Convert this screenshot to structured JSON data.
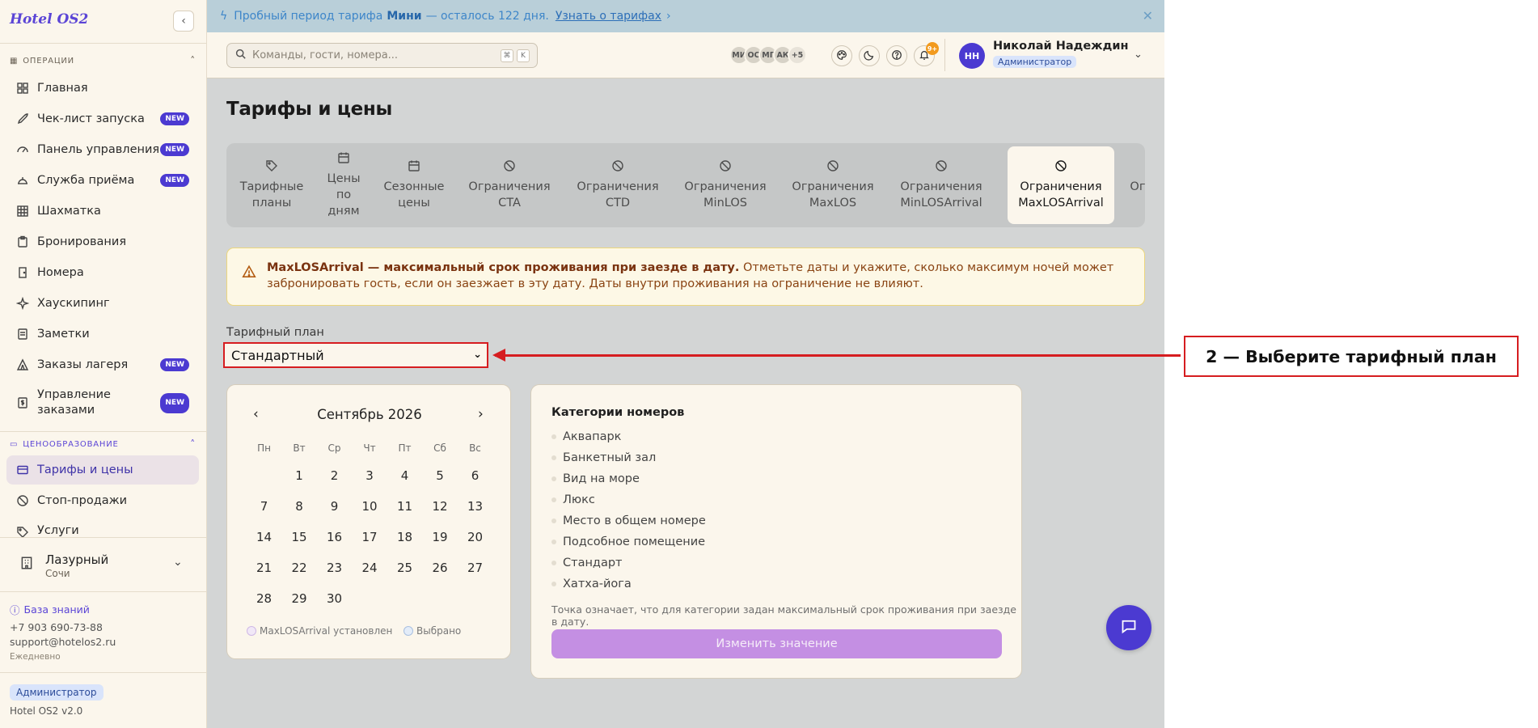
{
  "sidebar": {
    "logo": "Hotel OS2",
    "sections": {
      "operations": "ОПЕРАЦИИ",
      "pricing": "ЦЕНООБРАЗОВАНИЕ"
    },
    "items": [
      {
        "label": "Главная"
      },
      {
        "label": "Чек-лист запуска",
        "badge": "NEW"
      },
      {
        "label": "Панель управления",
        "badge": "NEW"
      },
      {
        "label": "Служба приёма",
        "badge": "NEW"
      },
      {
        "label": "Шахматка"
      },
      {
        "label": "Бронирования"
      },
      {
        "label": "Номера"
      },
      {
        "label": "Хаускипинг"
      },
      {
        "label": "Заметки"
      },
      {
        "label": "Заказы лагеря",
        "badge": "NEW"
      },
      {
        "label": "Управление заказами",
        "badge": "NEW"
      }
    ],
    "pricing_items": [
      {
        "label": "Тарифы и цены"
      },
      {
        "label": "Стоп-продажи"
      },
      {
        "label": "Услуги"
      }
    ],
    "hotel": {
      "name": "Лазурный",
      "city": "Сочи"
    },
    "knowledge_base": "База знаний",
    "phone": "+7 903 690-73-88",
    "email": "support@hotelos2.ru",
    "schedule": "Ежедневно",
    "role": "Администратор",
    "version": "Hotel OS2 v2.0"
  },
  "banner": {
    "prefix": "Пробный период тарифа",
    "plan": "Мини",
    "suffix": "— осталось 122 дня.",
    "link": "Узнать о тарифах"
  },
  "topbar": {
    "search_placeholder": "Команды, гости, номера...",
    "kbd1": "⌘",
    "kbd2": "K",
    "avatars": [
      "МИ",
      "ОС",
      "МГ",
      "АК",
      "+5"
    ],
    "notif_count": "9+",
    "user_initials": "НН",
    "user_name": "Николай Надеждин",
    "user_role": "Администратор"
  },
  "page": {
    "title": "Тарифы и цены",
    "tabs": [
      {
        "label": "Тарифные\nпланы"
      },
      {
        "label": "Цены\nпо\nдням"
      },
      {
        "label": "Сезонные\nцены"
      },
      {
        "label": "Ограничения\nCTA"
      },
      {
        "label": "Ограничения\nCTD"
      },
      {
        "label": "Ограничения\nMinLOS"
      },
      {
        "label": "Ограничения\nMaxLOS"
      },
      {
        "label": "Ограничения\nMinLOSArrival"
      },
      {
        "label": "Ограничения\nMaxLOSArrival"
      },
      {
        "label": "Ограничения\nFullPa"
      }
    ],
    "alert_bold": "MaxLOSArrival — максимальный срок проживания при заезде в дату.",
    "alert_text": "Отметьте даты и укажите, сколько максимум ночей может забронировать гость, если он заезжает в эту дату. Даты внутри проживания на ограничение не влияют.",
    "plan_label": "Тарифный план",
    "plan_value": "Стандартный",
    "calendar": {
      "month": "Сентябрь 2026",
      "weekdays": [
        "Пн",
        "Вт",
        "Ср",
        "Чт",
        "Пт",
        "Сб",
        "Вс"
      ],
      "days": [
        "",
        "1",
        "2",
        "3",
        "4",
        "5",
        "6",
        "7",
        "8",
        "9",
        "10",
        "11",
        "12",
        "13",
        "14",
        "15",
        "16",
        "17",
        "18",
        "19",
        "20",
        "21",
        "22",
        "23",
        "24",
        "25",
        "26",
        "27",
        "28",
        "29",
        "30"
      ],
      "legend_set": "MaxLOSArrival установлен",
      "legend_selected": "Выбрано"
    },
    "categories": {
      "title": "Категории номеров",
      "items": [
        "Аквапарк",
        "Банкетный зал",
        "Вид на море",
        "Люкс",
        "Место в общем номере",
        "Подсобное помещение",
        "Стандарт",
        "Хатха-йога"
      ],
      "note": "Точка означает, что для категории задан максимальный срок проживания при заезде в дату.",
      "button": "Изменить значение"
    }
  },
  "annotation": {
    "text": "2 — Выберите тарифный план"
  },
  "colors": {
    "accent": "#4b3ad1",
    "annotation": "#d61d20",
    "alert_border": "#ecd67c"
  }
}
